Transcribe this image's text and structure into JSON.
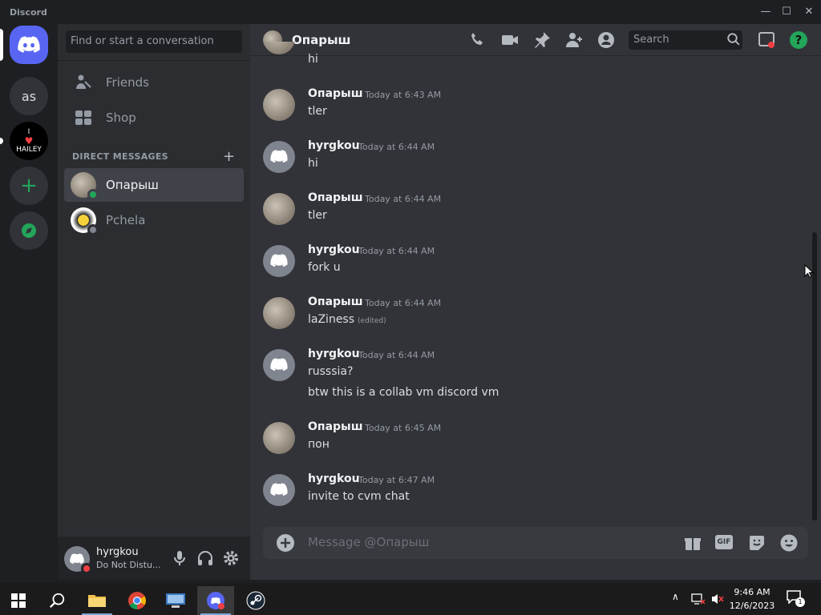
{
  "window": {
    "app_name": "Discord",
    "minimize": "—",
    "maximize": "☐",
    "close": "✕"
  },
  "servers": {
    "avatar_as": "as",
    "hailey_top": "I",
    "hailey_bottom": "HAILEY"
  },
  "sidebar": {
    "search_placeholder": "Find or start a conversation",
    "nav": [
      {
        "label": "Friends"
      },
      {
        "label": "Shop"
      }
    ],
    "dm_header": "DIRECT MESSAGES",
    "dm_add": "+",
    "dms": [
      {
        "name": "Опарыш"
      },
      {
        "name": "Pchela"
      }
    ]
  },
  "user_panel": {
    "name": "hyrgkou",
    "status": "Do Not Distu..."
  },
  "chat": {
    "channel_name": "Опарыш",
    "search_placeholder": "Search",
    "partial_text": "hi",
    "messages": [
      {
        "author": "Опарыш",
        "time": "Today at 6:43 AM",
        "lines": [
          "tler"
        ]
      },
      {
        "author": "hyrgkou",
        "time": "Today at 6:44 AM",
        "lines": [
          "hi"
        ]
      },
      {
        "author": "Опарыш",
        "time": "Today at 6:44 AM",
        "lines": [
          "tler"
        ]
      },
      {
        "author": "hyrgkou",
        "time": "Today at 6:44 AM",
        "lines": [
          "fork u"
        ]
      },
      {
        "author": "Опарыш",
        "time": "Today at 6:44 AM",
        "lines": [
          "laZiness"
        ],
        "edited": "(edited)"
      },
      {
        "author": "hyrgkou",
        "time": "Today at 6:44 AM",
        "lines": [
          "russsia?",
          "btw this is a collab vm discord vm"
        ]
      },
      {
        "author": "Опарыш",
        "time": "Today at 6:45 AM",
        "lines": [
          "пон"
        ]
      },
      {
        "author": "hyrgkou",
        "time": "Today at 6:47 AM",
        "lines": [
          "invite to cvm chat"
        ]
      }
    ],
    "composer_placeholder": "Message @Опарыш",
    "gif_label": "GIF"
  },
  "taskbar": {
    "time": "9:46 AM",
    "date": "12/6/2023",
    "notif_count": "1"
  },
  "colors": {
    "blurple": "#5865f2",
    "online": "#23a55a",
    "dnd": "#f23f43",
    "help": "#23a55a"
  }
}
